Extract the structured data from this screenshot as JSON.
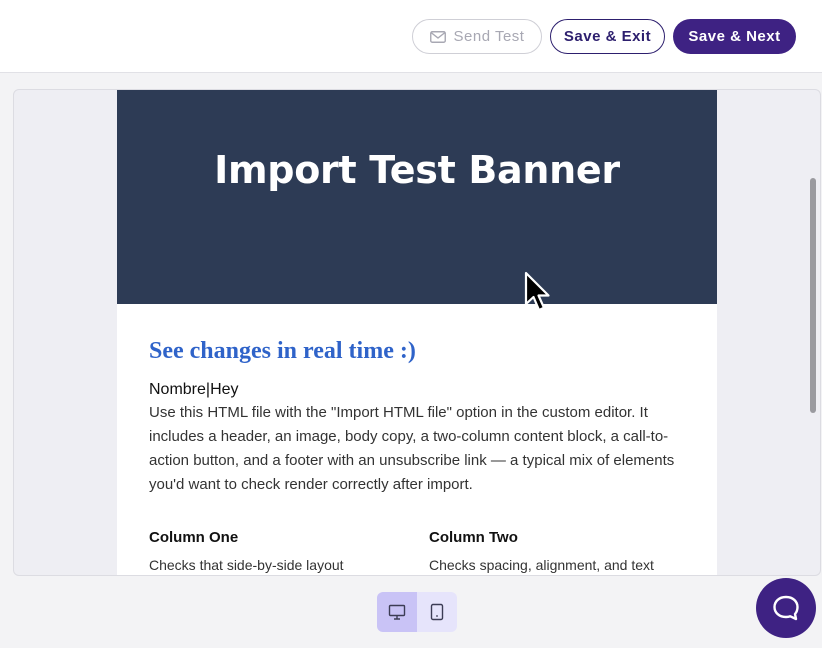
{
  "toolbar": {
    "send_test_label": "Send Test",
    "save_exit_label": "Save & Exit",
    "save_next_label": "Save & Next"
  },
  "email": {
    "banner_title": "Import Test Banner",
    "headline": "See changes in real time :)",
    "name_line": "Nombre|Hey",
    "paragraph": "Use this HTML file with the \"Import HTML file\" option in the custom editor. It includes a header, an image, body copy, a two-column content block, a call-to-action button, and a footer with an unsubscribe link — a typical mix of elements you'd want to check render correctly after import.",
    "columns": [
      {
        "title": "Column One",
        "text": "Checks that side-by-side layout blocks"
      },
      {
        "title": "Column Two",
        "text": "Checks spacing, alignment, and text"
      }
    ]
  },
  "device_toggle": {
    "selected": "desktop",
    "options": [
      "desktop-icon",
      "tablet-icon"
    ]
  },
  "icons": {
    "send_test": "envelope-icon",
    "chat": "chat-bubble-icon"
  },
  "colors": {
    "primary": "#3e2283",
    "banner_bg": "#2d3b55",
    "headline": "#2f63c9"
  }
}
